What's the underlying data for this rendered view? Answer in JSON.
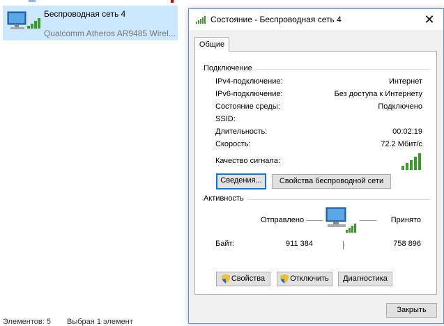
{
  "explorer": {
    "adapter_name": "Беспроводная сеть 4",
    "adapter_device": "Qualcomm Atheros AR9485 Wirel...",
    "status_count": "Элементов: 5",
    "status_selected": "Выбран 1 элемент"
  },
  "dialog": {
    "title": "Состояние - Беспроводная сеть 4",
    "close_glyph": "✕",
    "tab_general": "Общие",
    "connection": {
      "title": "Подключение",
      "rows": [
        {
          "label": "IPv4-подключение:",
          "value": "Интернет"
        },
        {
          "label": "IPv6-подключение:",
          "value": "Без доступа к Интернету"
        },
        {
          "label": "Состояние среды:",
          "value": "Подключено"
        },
        {
          "label": "SSID:",
          "value": ""
        },
        {
          "label": "Длительность:",
          "value": "00:02:19"
        },
        {
          "label": "Скорость:",
          "value": "72.2 Мбит/с"
        }
      ],
      "signal_label": "Качество сигнала:",
      "signal_bars_filled": 5,
      "details_button": "Сведения...",
      "wireless_props_button": "Свойства беспроводной сети"
    },
    "activity": {
      "title": "Активность",
      "sent_label": "Отправлено",
      "received_label": "Принято",
      "bytes_label": "Байт:",
      "bytes_sent": "911 384",
      "bytes_received": "758 896"
    },
    "buttons": {
      "properties": "Свойства",
      "disable": "Отключить",
      "diagnostics": "Диагностика",
      "close": "Закрыть"
    },
    "icons": {
      "title": "wifi-signal-icon",
      "shield": "uac-shield-icon",
      "network": "network-computer-icon"
    },
    "colors": {
      "signal_green": "#3c9a2a",
      "accent_blue": "#0078d7",
      "selection": "#cce8ff"
    }
  }
}
